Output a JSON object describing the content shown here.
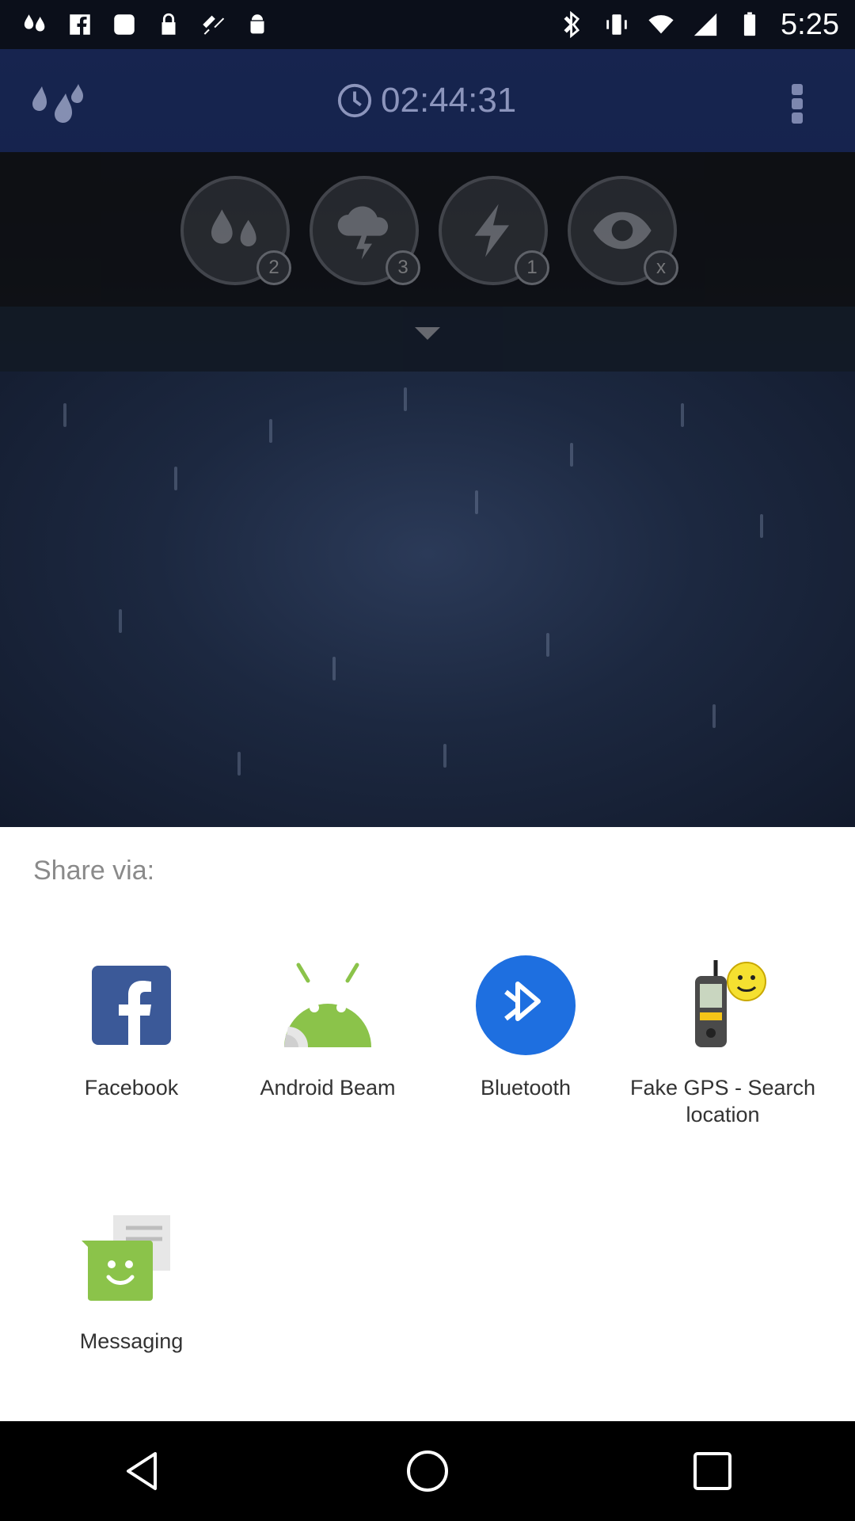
{
  "status_bar": {
    "time": "5:25",
    "left_icons": [
      "drops-icon",
      "facebook-icon",
      "square-icon",
      "lock-icon",
      "gps-icon",
      "android-icon"
    ],
    "right_icons": [
      "bluetooth-icon",
      "vibrate-icon",
      "wifi-icon",
      "signal-icon",
      "battery-icon"
    ]
  },
  "app": {
    "timer": "02:44:31",
    "effects": [
      {
        "name": "rain",
        "badge": "2"
      },
      {
        "name": "thunderstorm",
        "badge": "3"
      },
      {
        "name": "lightning",
        "badge": "1"
      },
      {
        "name": "eye",
        "badge": "x"
      }
    ]
  },
  "share_sheet": {
    "title": "Share via:",
    "apps": [
      {
        "label": "Facebook"
      },
      {
        "label": "Android Beam"
      },
      {
        "label": "Bluetooth"
      },
      {
        "label": "Fake GPS - Search location"
      },
      {
        "label": "Messaging"
      }
    ]
  },
  "nav": {
    "buttons": [
      "back",
      "home",
      "recents"
    ]
  },
  "colors": {
    "facebook": "#3b5998",
    "android_green": "#8bc34a",
    "bluetooth": "#1e6fe0",
    "sheet_bg": "#ffffff"
  }
}
